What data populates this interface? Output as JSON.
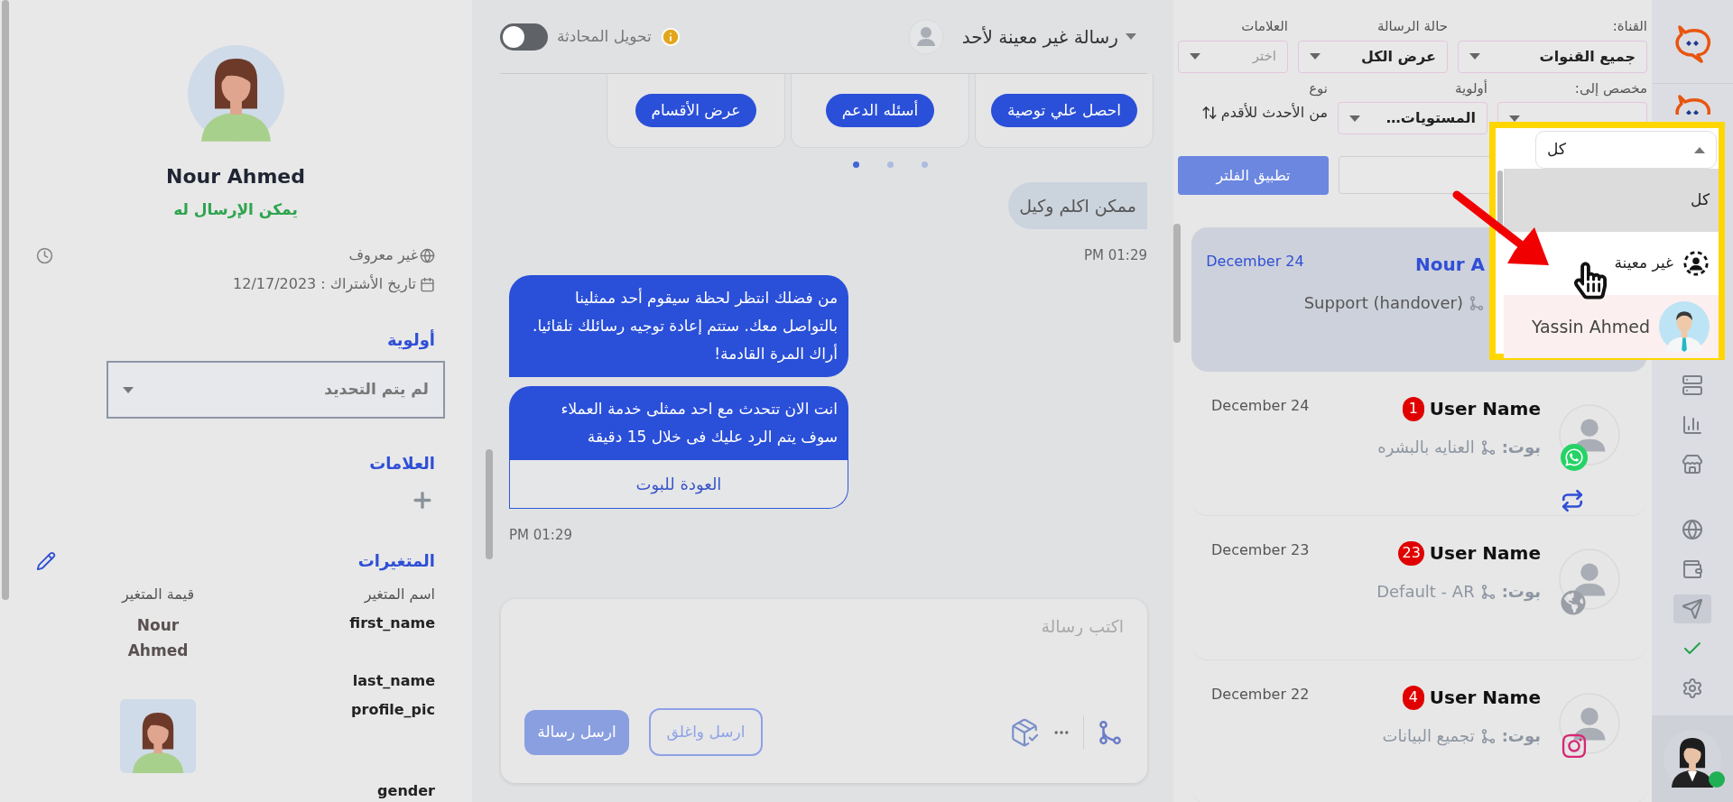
{
  "contact": {
    "name": "Nour Ahmed",
    "status": "يمكن الإرسال له",
    "location": "غير معروف",
    "subscribed": "تاريخ الأشتراك : 12/17/2023",
    "priority": {
      "heading": "أولوية",
      "value": "لم يتم التحديد"
    },
    "tags": {
      "heading": "العلامات"
    },
    "variables": {
      "heading": "المتغيرات",
      "columns": [
        "اسم المتغير",
        "قيمة المتغير"
      ],
      "rows": [
        {
          "name": "first_name",
          "kind": "text",
          "value": "Nour Ahmed"
        },
        {
          "name": "last_name",
          "kind": "text"
        },
        {
          "name": "profile_pic"
        },
        {
          "name": "gender",
          "kind": "text"
        }
      ]
    }
  },
  "chat": {
    "header": {
      "assignee": "رسالة غير معينة لأحد",
      "handover_label": "تحويل المحادثة",
      "handover_on": false
    },
    "quick_replies": [
      {
        "label": "احصل علي توصية"
      },
      {
        "label": "أسئله الدعم"
      },
      {
        "label": "عرض الأقسام"
      }
    ],
    "carousel_dots": [
      {
        "selected": true
      },
      {
        "selected": false
      },
      {
        "selected": false
      }
    ],
    "messages": [
      {
        "kind": "user",
        "bubbles": [
          {
            "text": "ممكن اكلم وكيل"
          }
        ],
        "time": "PM 01:29"
      },
      {
        "kind": "bot",
        "bubbles": [
          {
            "text": "من فضلك انتظر لحظة سيقوم أحد ممثلينا بالتواصل معك. ستتم إعادة توجيه رسائلك تلقائيا. أراك المرة القادمة!"
          },
          {
            "text": "انت الان تتحدث مع احد ممثلى خدمة العملاء سوف يتم الرد عليك فى خلال 15 دقيقة",
            "button": "العودة للبوت"
          }
        ],
        "time": "PM 01:29"
      }
    ],
    "composer": {
      "placeholder": "اكتب رسالة",
      "send_close": "ارسل واغلق",
      "send": "ارسل رسالة"
    }
  },
  "filters": {
    "channel": {
      "label": "القناة:",
      "value": "جميع القنوات"
    },
    "message_status": {
      "label": "حالة الرسالة",
      "value": "عرض الكل"
    },
    "tags": {
      "label": "العلامات",
      "placeholder": "اختر"
    },
    "assigned_to": {
      "label": "مخصص إلى:"
    },
    "priority": {
      "label": "أولوية",
      "value": "المستويات…"
    },
    "sort": {
      "label": "نوع",
      "value": "من الأحدث للأقدم"
    },
    "apply_button": "تطبيق الفلتر"
  },
  "conversations": [
    {
      "date": "December 24",
      "name": "Nour A",
      "flow": "Support (handover)",
      "selected": true,
      "avatar": false,
      "transfer": false
    },
    {
      "date": "December 24",
      "name": "User Name",
      "unread": "1",
      "bot_label": "بوت:",
      "flow": "العنايه بالبشره",
      "kind": "whatsapp",
      "transfer": true,
      "selected": false,
      "avatar": true
    },
    {
      "date": "December 23",
      "name": "User Name",
      "unread": "23",
      "bot_label": "بوت:",
      "flow": "Default - AR",
      "kind": "web",
      "transfer": false,
      "selected": false,
      "avatar": true
    },
    {
      "date": "December 22",
      "name": "User Name",
      "unread": "4",
      "bot_label": "بوت:",
      "flow": "تجميع البيانات",
      "kind": "instagram",
      "transfer": false,
      "selected": false,
      "avatar": true
    }
  ],
  "assignee_dropdown": {
    "value": "كل",
    "options": [
      {
        "label": "كل",
        "kind": "all",
        "selected": true,
        "highlighted": false
      },
      {
        "label": "غير معينة",
        "kind": "unassigned",
        "selected": false,
        "highlighted": false
      },
      {
        "label": "Yassin Ahmed",
        "kind": "agent",
        "selected": false,
        "highlighted": true
      }
    ]
  },
  "nav_groups": [
    {
      "items": [
        {
          "kind": "server",
          "selected": false
        },
        {
          "kind": "chart",
          "selected": false
        },
        {
          "kind": "store",
          "selected": false
        }
      ]
    },
    {
      "items": [
        {
          "kind": "globe",
          "selected": false
        },
        {
          "kind": "wallet",
          "selected": false
        },
        {
          "kind": "send",
          "selected": true
        },
        {
          "kind": "check",
          "selected": false
        },
        {
          "kind": "settings",
          "selected": false
        }
      ]
    }
  ],
  "agent": {
    "online": true
  }
}
